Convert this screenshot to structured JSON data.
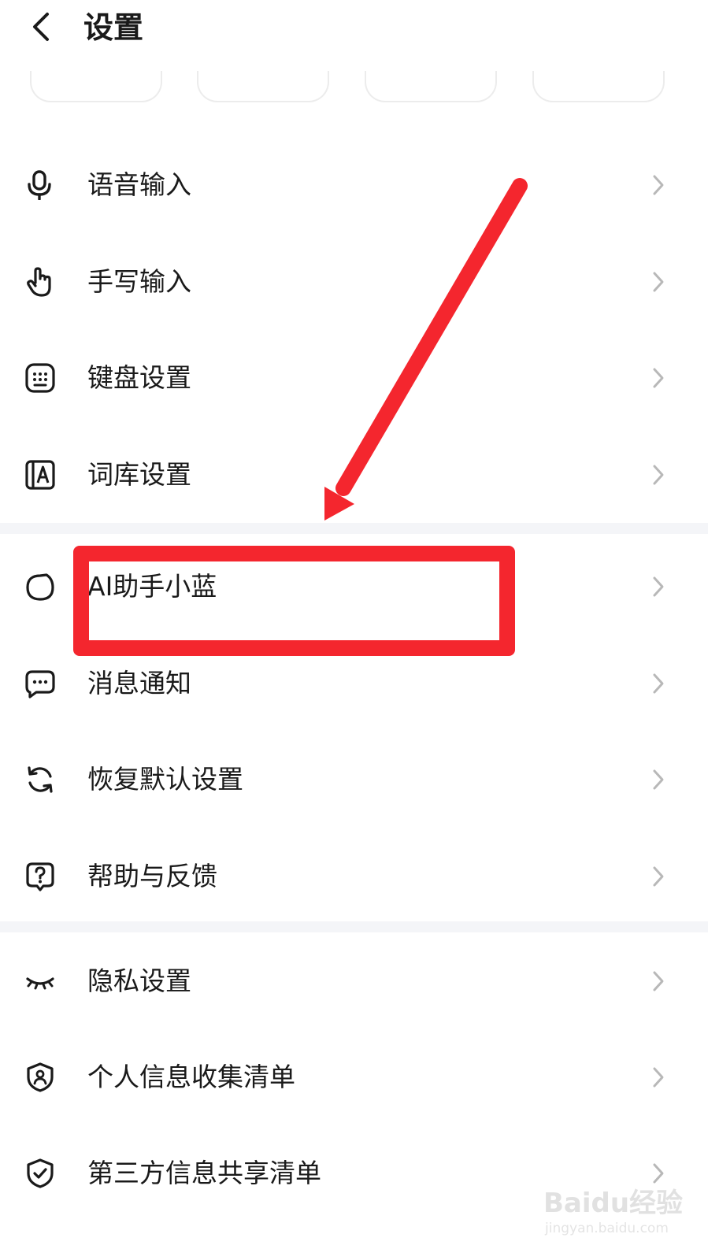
{
  "header": {
    "title": "设置"
  },
  "group1": [
    {
      "label": "语音输入",
      "icon": "microphone-icon"
    },
    {
      "label": "手写输入",
      "icon": "hand-pointer-icon"
    },
    {
      "label": "键盘设置",
      "icon": "keyboard-icon"
    },
    {
      "label": "词库设置",
      "icon": "dictionary-icon"
    }
  ],
  "group2": [
    {
      "label": "AI助手小蓝",
      "icon": "ai-assistant-icon"
    },
    {
      "label": "消息通知",
      "icon": "message-icon"
    },
    {
      "label": "恢复默认设置",
      "icon": "refresh-icon"
    },
    {
      "label": "帮助与反馈",
      "icon": "help-icon"
    }
  ],
  "group3": [
    {
      "label": "隐私设置",
      "icon": "eye-closed-icon"
    },
    {
      "label": "个人信息收集清单",
      "icon": "shield-person-icon"
    },
    {
      "label": "第三方信息共享清单",
      "icon": "shield-check-icon"
    }
  ],
  "annotation": {
    "color": "#f4262e"
  },
  "watermark": {
    "text": "Baidu经验",
    "sub": "jingyan.baidu.com"
  }
}
